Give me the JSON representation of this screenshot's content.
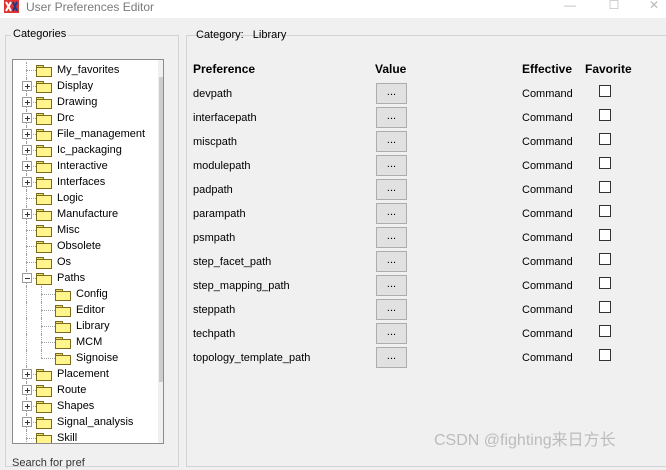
{
  "window": {
    "title": "User Preferences Editor",
    "minimize_glyph": "—",
    "maximize_glyph": "☐",
    "close_glyph": "✕"
  },
  "categories_panel": {
    "label": "Categories",
    "tree": [
      {
        "label": "My_favorites",
        "level": 0,
        "expander": "none"
      },
      {
        "label": "Display",
        "level": 0,
        "expander": "plus"
      },
      {
        "label": "Drawing",
        "level": 0,
        "expander": "plus"
      },
      {
        "label": "Drc",
        "level": 0,
        "expander": "plus"
      },
      {
        "label": "File_management",
        "level": 0,
        "expander": "plus"
      },
      {
        "label": "Ic_packaging",
        "level": 0,
        "expander": "plus"
      },
      {
        "label": "Interactive",
        "level": 0,
        "expander": "plus"
      },
      {
        "label": "Interfaces",
        "level": 0,
        "expander": "plus"
      },
      {
        "label": "Logic",
        "level": 0,
        "expander": "none"
      },
      {
        "label": "Manufacture",
        "level": 0,
        "expander": "plus"
      },
      {
        "label": "Misc",
        "level": 0,
        "expander": "none"
      },
      {
        "label": "Obsolete",
        "level": 0,
        "expander": "none"
      },
      {
        "label": "Os",
        "level": 0,
        "expander": "none"
      },
      {
        "label": "Paths",
        "level": 0,
        "expander": "minus"
      },
      {
        "label": "Config",
        "level": 1,
        "expander": "none"
      },
      {
        "label": "Editor",
        "level": 1,
        "expander": "none"
      },
      {
        "label": "Library",
        "level": 1,
        "expander": "none"
      },
      {
        "label": "MCM",
        "level": 1,
        "expander": "none"
      },
      {
        "label": "Signoise",
        "level": 1,
        "expander": "none"
      },
      {
        "label": "Placement",
        "level": 0,
        "expander": "plus"
      },
      {
        "label": "Route",
        "level": 0,
        "expander": "plus"
      },
      {
        "label": "Shapes",
        "level": 0,
        "expander": "plus"
      },
      {
        "label": "Signal_analysis",
        "level": 0,
        "expander": "plus"
      },
      {
        "label": "Skill",
        "level": 0,
        "expander": "none"
      }
    ],
    "scroll_up_glyph": "▲",
    "scroll_down_glyph": "▼"
  },
  "main_panel": {
    "category_label": "Category:",
    "category_value": "Library",
    "columns": {
      "preference": "Preference",
      "value": "Value",
      "effective": "Effective",
      "favorite": "Favorite"
    },
    "rows": [
      {
        "preference": "devpath",
        "value_button": "...",
        "effective": "Command",
        "favorite": false
      },
      {
        "preference": "interfacepath",
        "value_button": "...",
        "effective": "Command",
        "favorite": false
      },
      {
        "preference": "miscpath",
        "value_button": "...",
        "effective": "Command",
        "favorite": false
      },
      {
        "preference": "modulepath",
        "value_button": "...",
        "effective": "Command",
        "favorite": false
      },
      {
        "preference": "padpath",
        "value_button": "...",
        "effective": "Command",
        "favorite": false
      },
      {
        "preference": "parampath",
        "value_button": "...",
        "effective": "Command",
        "favorite": false
      },
      {
        "preference": "psmpath",
        "value_button": "...",
        "effective": "Command",
        "favorite": false
      },
      {
        "preference": "step_facet_path",
        "value_button": "...",
        "effective": "Command",
        "favorite": false
      },
      {
        "preference": "step_mapping_path",
        "value_button": "...",
        "effective": "Command",
        "favorite": false
      },
      {
        "preference": "steppath",
        "value_button": "...",
        "effective": "Command",
        "favorite": false
      },
      {
        "preference": "techpath",
        "value_button": "...",
        "effective": "Command",
        "favorite": false
      },
      {
        "preference": "topology_template_path",
        "value_button": "...",
        "effective": "Command",
        "favorite": false
      }
    ]
  },
  "bottom_text": "Search for pref",
  "watermark": "CSDN @fighting来日方长",
  "colors": {
    "window_bg": "#f0f0f0",
    "folder_fill": "#fff58c",
    "folder_border": "#7d6a1a",
    "button_bg": "#e1e1e1"
  }
}
